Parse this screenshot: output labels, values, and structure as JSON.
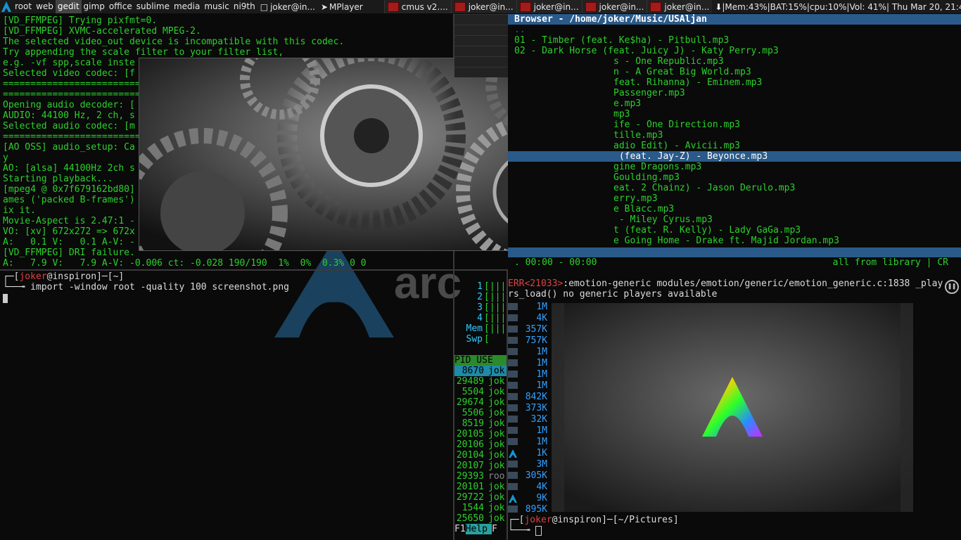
{
  "topbar": {
    "tags": [
      "root",
      "web",
      "gedit",
      "gimp",
      "office",
      "sublime",
      "media",
      "music",
      "ni9th"
    ],
    "active_tag": "gedit",
    "tasks": [
      "joker@in...",
      "MPlayer",
      "cmus v2....",
      "joker@in...",
      "joker@in...",
      "joker@in...",
      "joker@in..."
    ],
    "status": "|Mem:43%|BAT:15%|cpu:10%|Vol: 41%| Thu Mar 20, 21:47"
  },
  "mplayer_log": [
    "[VD_FFMPEG] Trying pixfmt=0.",
    "[VD_FFMPEG] XVMC-accelerated MPEG-2.",
    "The selected video_out device is incompatible with this codec.",
    "Try appending the scale filter to your filter list,",
    "e.g. -vf spp,scale inste",
    "Selected video codec: [f",
    "==============================",
    "==============================",
    "Opening audio decoder: [",
    "AUDIO: 44100 Hz, 2 ch, s",
    "Selected audio codec: [m",
    "==============================",
    "[AO OSS] audio_setup: Ca",
    "y",
    "AO: [alsa] 44100Hz 2ch s",
    "Starting playback...",
    "[mpeg4 @ 0x7f679162bd80]",
    "ames ('packed B-frames')",
    "ix it.",
    "Movie-Aspect is 2.47:1 -",
    "VO: [xv] 672x272 => 672x",
    "A:   0.1 V:   0.1 A-V: -",
    "[VD_FFMPEG] DRI failure.",
    "A:   7.9 V:   7.9 A-V: -0.006 ct: -0.028 190/190  1%  0%  0.3% 0 0"
  ],
  "shell1": {
    "prompt_user": "joker",
    "prompt_host": "inspiron",
    "prompt_dir": "~",
    "command": "import -window root -quality 100 screenshot.png"
  },
  "cmus": {
    "header": "Browser - /home/joker/Music/USAljan",
    "tracks": [
      "01 - Timber (feat. Ke$ha) - Pitbull.mp3",
      "02 - Dark Horse (feat. Juicy J) - Katy Perry.mp3",
      "s - One Republic.mp3",
      "n - A Great Big World.mp3",
      "feat. Rihanna) - Eminem.mp3",
      "Passenger.mp3",
      "e.mp3",
      "mp3",
      "ife - One Direction.mp3",
      "tille.mp3",
      "adio Edit) - Avicii.mp3",
      " (feat. Jay-Z) - Beyonce.mp3",
      "gine Dragons.mp3",
      "Goulding.mp3",
      "eat. 2 Chainz) - Jason Derulo.mp3",
      "erry.mp3",
      "e Blacc.mp3",
      " - Miley Cyrus.mp3",
      "t (feat. R. Kelly) - Lady GaGa.mp3",
      "e Going Home - Drake ft. Majid Jordan.mp3"
    ],
    "selected_index": 11,
    "status_left": ". 00:00 - 00:00",
    "status_right": "all from library | CR"
  },
  "htop": {
    "cpu_labels": [
      "1",
      "2",
      "3",
      "4",
      "Mem",
      "Swp"
    ],
    "col_header": "PID USE",
    "rows": [
      {
        "pid": "8670",
        "user": "jok"
      },
      {
        "pid": "29489",
        "user": "jok"
      },
      {
        "pid": "5504",
        "user": "jok"
      },
      {
        "pid": "29674",
        "user": "jok"
      },
      {
        "pid": "5506",
        "user": "jok"
      },
      {
        "pid": "8519",
        "user": "jok"
      },
      {
        "pid": "20105",
        "user": "jok"
      },
      {
        "pid": "20106",
        "user": "jok"
      },
      {
        "pid": "20104",
        "user": "jok"
      },
      {
        "pid": "20107",
        "user": "jok"
      },
      {
        "pid": "29393",
        "user": "roo"
      },
      {
        "pid": "20101",
        "user": "jok"
      },
      {
        "pid": "29722",
        "user": "jok"
      },
      {
        "pid": "1544",
        "user": "jok"
      },
      {
        "pid": "25650",
        "user": "jok"
      }
    ],
    "footer_key": "F1",
    "footer_label": "Help",
    "footer_next": "F"
  },
  "files": {
    "sizes": [
      "1M",
      "4K",
      "357K",
      "757K",
      "1M",
      "1M",
      "1M",
      "1M",
      "842K",
      "373K",
      "32K",
      "1M",
      "1M",
      "1K",
      "3M",
      "305K",
      "4K",
      "9K",
      "895K"
    ]
  },
  "err": {
    "prefix": "ERR<21033>",
    "line1": ":emotion-generic modules/emotion/generic/emotion_generic.c:1838 _play",
    "line2": "rs_load() no generic players available"
  },
  "shell2": {
    "prompt_user": "joker",
    "prompt_host": "inspiron",
    "prompt_dir": "~/Pictures"
  },
  "wallpaper_text": "arc",
  "colors": {
    "accent": "#2a5a8a",
    "green": "#2bd12b",
    "err": "#e04040",
    "arch": "#1793d1"
  }
}
